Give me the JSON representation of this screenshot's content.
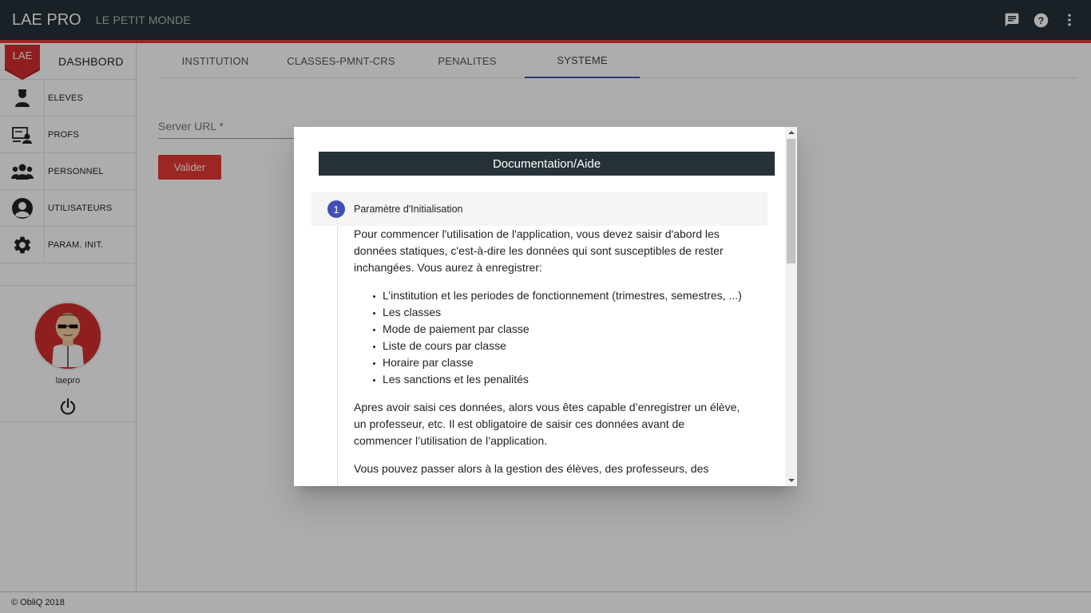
{
  "topbar": {
    "app_title": "LAE PRO",
    "school_name": "LE PETIT MONDE",
    "icons": [
      "chat-icon",
      "help-icon",
      "more-vert-icon"
    ]
  },
  "sidebar": {
    "logo_text": "LAE",
    "dashboard_label": "DASHBORD",
    "items": [
      {
        "label": "ELEVES",
        "icon": "student-icon"
      },
      {
        "label": "PROFS",
        "icon": "teacher-icon"
      },
      {
        "label": "PERSONNEL",
        "icon": "group-icon"
      },
      {
        "label": "UTILISATEURS",
        "icon": "user-icon"
      },
      {
        "label": "PARAM. INIT.",
        "icon": "gear-icon"
      }
    ],
    "username": "laepro"
  },
  "main": {
    "tabs": [
      {
        "label": "INSTITUTION"
      },
      {
        "label": "CLASSES-PMNT-CRS"
      },
      {
        "label": "PENALITES"
      },
      {
        "label": "SYSTEME"
      }
    ],
    "active_tab": "SYSTEME",
    "server_url_placeholder": "Server URL *",
    "valider_label": "Valider"
  },
  "footer": {
    "text": "© ObliQ 2018"
  },
  "dialog": {
    "title": "Documentation/Aide",
    "step_number": "1",
    "step_title": "Paramètre d'Initialisation",
    "intro": "Pour commencer l'utilisation de l'application, vous devez saisir d'abord les données statiques, c'est-à-dire les données qui sont susceptibles de rester inchangées. Vous aurez à enregistrer:",
    "list": [
      "L’institution et les periodes de fonctionnement (trimestres, semestres, ...)",
      "Les classes",
      "Mode de paiement par classe",
      "Liste de cours par classe",
      "Horaire par classe",
      "Les sanctions et les penalités"
    ],
    "after": "Apres avoir saisi ces données, alors vous êtes capable d’enregistrer un élève, un professeur, etc. Il est obligatoire de saisir ces données avant de commencer l’utilisation de l’application.",
    "cut_off": "Vous pouvez passer alors à la gestion des élèves, des professeurs, des"
  },
  "colors": {
    "topbar": "#263238",
    "accent_red": "#e53935",
    "tab_indicator": "#3f51b5",
    "step_circle": "#3f51b5"
  }
}
